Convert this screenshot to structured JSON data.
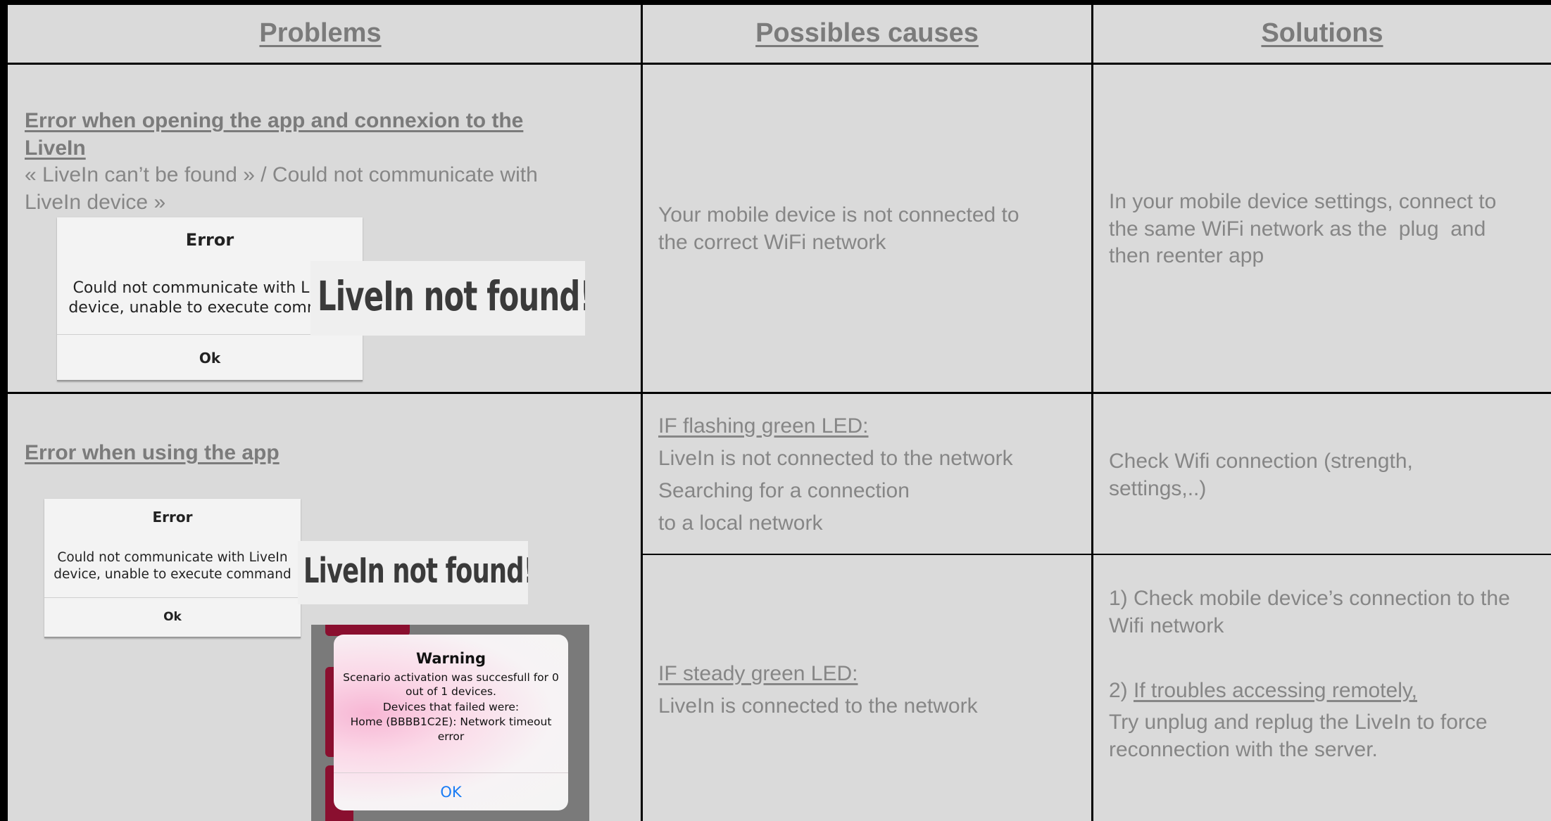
{
  "headers": {
    "problems": "Problems",
    "causes": "Possibles causes",
    "solutions": "Solutions"
  },
  "row1": {
    "title_line1": "Error when opening the app and connexion to the",
    "title_line2": "LiveIn",
    "desc_line1": "« LiveIn can’t be found » / Could not communicate with",
    "desc_line2": "LiveIn device »",
    "dialog": {
      "title": "Error",
      "body_line1": "Could not communicate with LiveIn",
      "body_line2": "device, unable to execute command",
      "ok": "Ok"
    },
    "badge": "LiveIn not found!",
    "cause_line1": "Your mobile device is not connected to",
    "cause_line2": "the correct WiFi network",
    "solution_line1": "In your mobile device settings, connect to",
    "solution_line2": "the same WiFi network as the  plug  and",
    "solution_line3": "then reenter app"
  },
  "row2": {
    "title": "Error when using the app",
    "dialog": {
      "title": "Error",
      "body_line1": "Could not communicate with LiveIn",
      "body_line2": "device, unable to execute command",
      "ok": "Ok"
    },
    "badge": "LiveIn not found!",
    "warning": {
      "title": "Warning",
      "line1": "Scenario activation was succesfull for 0",
      "line2": "out of 1 devices.",
      "line3": "Devices that failed were:",
      "line4": "Home (BBBB1C2E): Network timeout",
      "line5": "error",
      "ok": "OK"
    },
    "case_flashing": {
      "heading": "IF flashing green LED:",
      "line1": "LiveIn is not connected to the network",
      "line2": "Searching for a connection",
      "line3": "to a local network",
      "solution_line1": "Check Wifi connection (strength,",
      "solution_line2": "settings,..)"
    },
    "case_steady": {
      "heading": "IF steady green LED:",
      "line1": "LiveIn is connected to the network",
      "solution1_line1": "1) Check mobile device’s connection to the",
      "solution1_line2": "Wifi network",
      "solution2_prefix": "2) ",
      "solution2_link": "If troubles accessing remotely,",
      "solution2_line2": "Try unplug and replug the LiveIn to force",
      "solution2_line3": "reconnection with the server."
    }
  },
  "colors": {
    "background": "#dadada",
    "text": "#868686",
    "heading": "#7b7b7b",
    "ios_ok": "#1a7cf5",
    "strip": "#8a0f2f"
  }
}
